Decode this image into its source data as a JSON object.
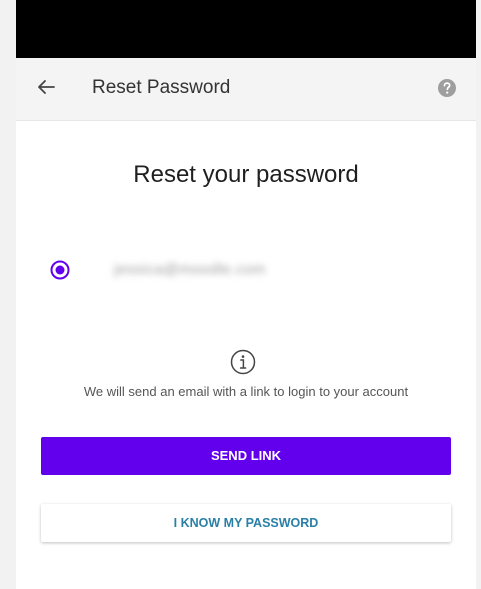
{
  "app_bar": {
    "title": "Reset Password",
    "back_icon": "arrow-back-icon",
    "help_icon": "help-circle-icon"
  },
  "main": {
    "heading": "Reset your password",
    "account": {
      "email": "jessica@moodle.com",
      "selected": true
    },
    "info_icon": "info-circle-icon",
    "info_text": "We will send an email with a link to login to your account"
  },
  "actions": {
    "send_link_label": "SEND LINK",
    "know_password_label": "I KNOW MY PASSWORD"
  },
  "colors": {
    "accent": "#6200ee",
    "link": "#2a7fa6",
    "status_bar": "#000000",
    "app_bar_bg": "#f4f4f4"
  }
}
